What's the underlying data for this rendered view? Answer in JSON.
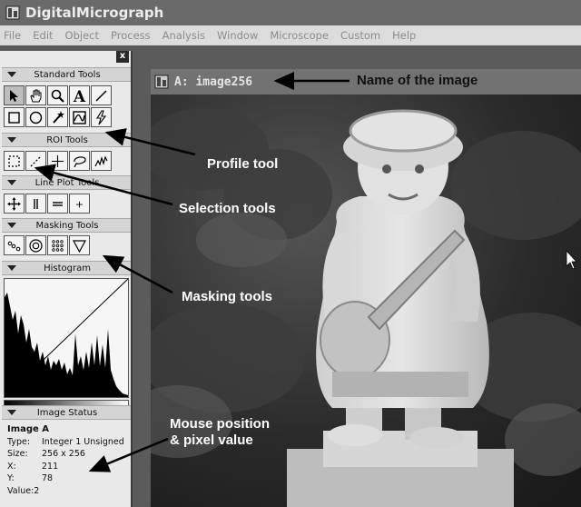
{
  "app": {
    "title": "DigitalMicrograph"
  },
  "menu": [
    "File",
    "Edit",
    "Object",
    "Process",
    "Analysis",
    "Window",
    "Microscope",
    "Custom",
    "Help"
  ],
  "palette": {
    "close_label": "x",
    "sections": {
      "standard": "Standard Tools",
      "roi": "ROI Tools",
      "line_plot": "Line Plot Tools",
      "masking": "Masking Tools",
      "histogram": "Histogram",
      "image_status": "Image Status"
    },
    "text_tool_glyph": "A",
    "plus_glyph": "+"
  },
  "image_status": {
    "name": "Image A",
    "type_label": "Type:",
    "type_value": "Integer 1 Unsigned",
    "size_label": "Size:",
    "size_value": "256 x 256",
    "x_label": "X:",
    "x_value": "211",
    "y_label": "Y:",
    "y_value": "78",
    "value_label": "Value:",
    "value_value": "2"
  },
  "image_window": {
    "title": "A: image256"
  },
  "annotations": {
    "name_of_image": "Name of the image",
    "profile_tool": "Profile tool",
    "selection_tools": "Selection tools",
    "masking_tools": "Masking tools",
    "mouse_position_line1": "Mouse position",
    "mouse_position_line2": "& pixel value"
  },
  "icons": [
    "app-icon",
    "arrow-pointer-icon",
    "hand-icon",
    "magnifier-icon",
    "text-icon",
    "line-icon",
    "rectangle-icon",
    "oval-icon",
    "wand-icon",
    "profile-icon",
    "lightning-icon",
    "rect-roi-icon",
    "line-roi-icon",
    "crosshair-icon",
    "lasso-icon",
    "freehand-icon",
    "move-icon",
    "vertical-bars-icon",
    "horizontal-bars-icon",
    "plus-icon",
    "dots-icon",
    "target-icon",
    "grid-dots-icon",
    "triangle-icon",
    "close-icon",
    "window-icon",
    "mouse-cursor-icon"
  ],
  "colors": {
    "titlebar": "#6a6a6a",
    "menubar": "#dcdcdc",
    "palette": "#e9e9e9",
    "annotation": "#ffffff",
    "annotation_dark": "#111111"
  }
}
